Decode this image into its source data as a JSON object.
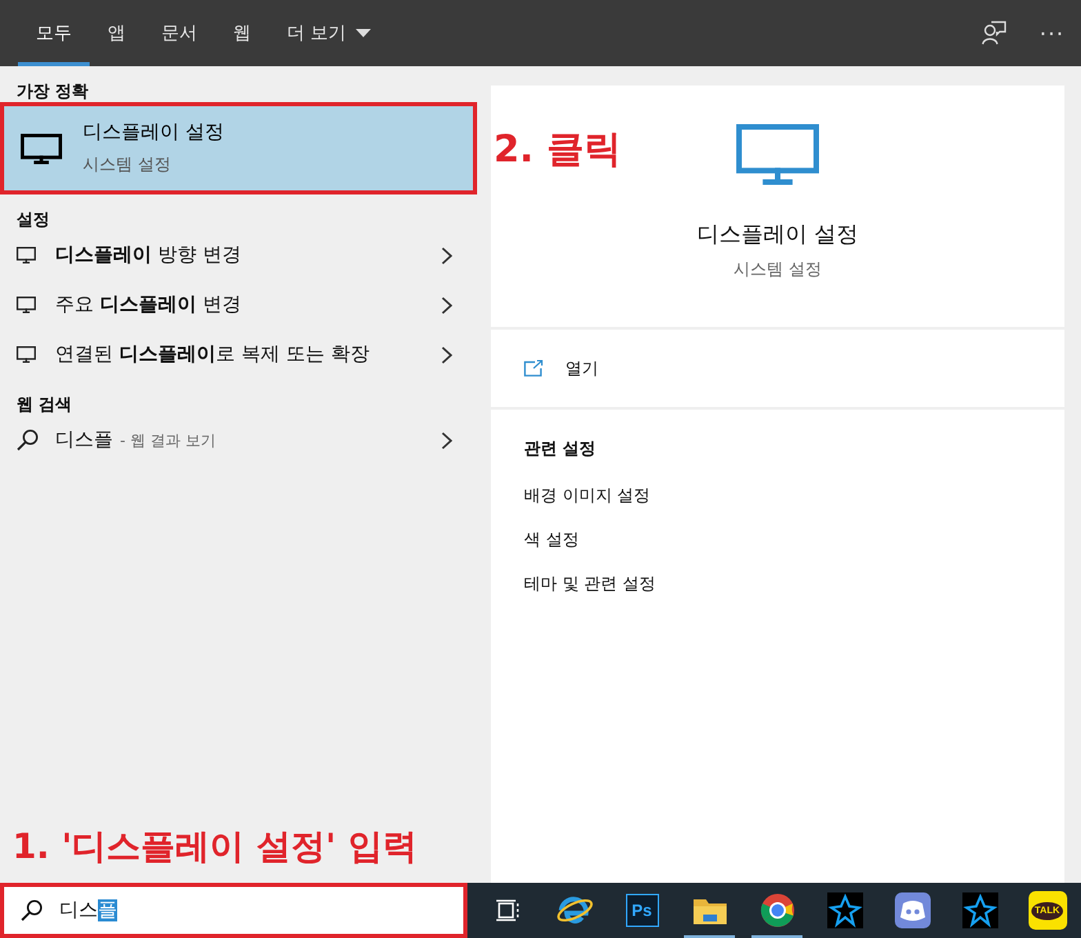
{
  "tabs": [
    {
      "label": "모두",
      "selected": true
    },
    {
      "label": "앱",
      "selected": false
    },
    {
      "label": "문서",
      "selected": false
    },
    {
      "label": "웹",
      "selected": false
    },
    {
      "label": "더 보기",
      "selected": false,
      "kind": "dropdown"
    }
  ],
  "top_actions": [
    {
      "kind": "feedback"
    },
    {
      "kind": "more",
      "label": "···"
    }
  ],
  "best_match": {
    "heading": "가장 정확",
    "title": "디스플레이 설정",
    "subtitle": "시스템 설정",
    "selected": true,
    "annotated": true
  },
  "settings": {
    "heading": "설정",
    "items": [
      {
        "label": "**디스플레이** 방향 변경"
      },
      {
        "label": "주요 **디스플레이** 변경"
      },
      {
        "label": "연결된 **디스플레이**로 복제 또는 확장"
      }
    ]
  },
  "web_search": {
    "heading": "웹 검색",
    "query": "디스플",
    "suffix": "- 웹 결과 보기"
  },
  "annotations": [
    {
      "kind": "detail",
      "text": "2. 클릭"
    },
    {
      "kind": "search",
      "text": "1. '디스플레이 설정' 입력"
    }
  ],
  "detail": {
    "title": "디스플레이 설정",
    "subtitle": "시스템 설정",
    "open": "열기",
    "related_heading": "관련 설정",
    "related": [
      "배경 이미지 설정",
      "색 설정",
      "테마 및 관련 설정"
    ]
  },
  "search": {
    "value": "디스",
    "composing": "플",
    "annotated": true
  },
  "taskbar": [
    {
      "kind": "taskview",
      "running": false
    },
    {
      "kind": "ie",
      "running": false
    },
    {
      "kind": "ps",
      "label": "Ps",
      "running": false
    },
    {
      "kind": "folder",
      "running": true
    },
    {
      "kind": "chrome",
      "running": true
    },
    {
      "kind": "bnet",
      "running": false
    },
    {
      "kind": "discord",
      "running": false
    },
    {
      "kind": "bnet",
      "running": false
    },
    {
      "kind": "kakao",
      "label": "TALK",
      "running": false
    }
  ]
}
